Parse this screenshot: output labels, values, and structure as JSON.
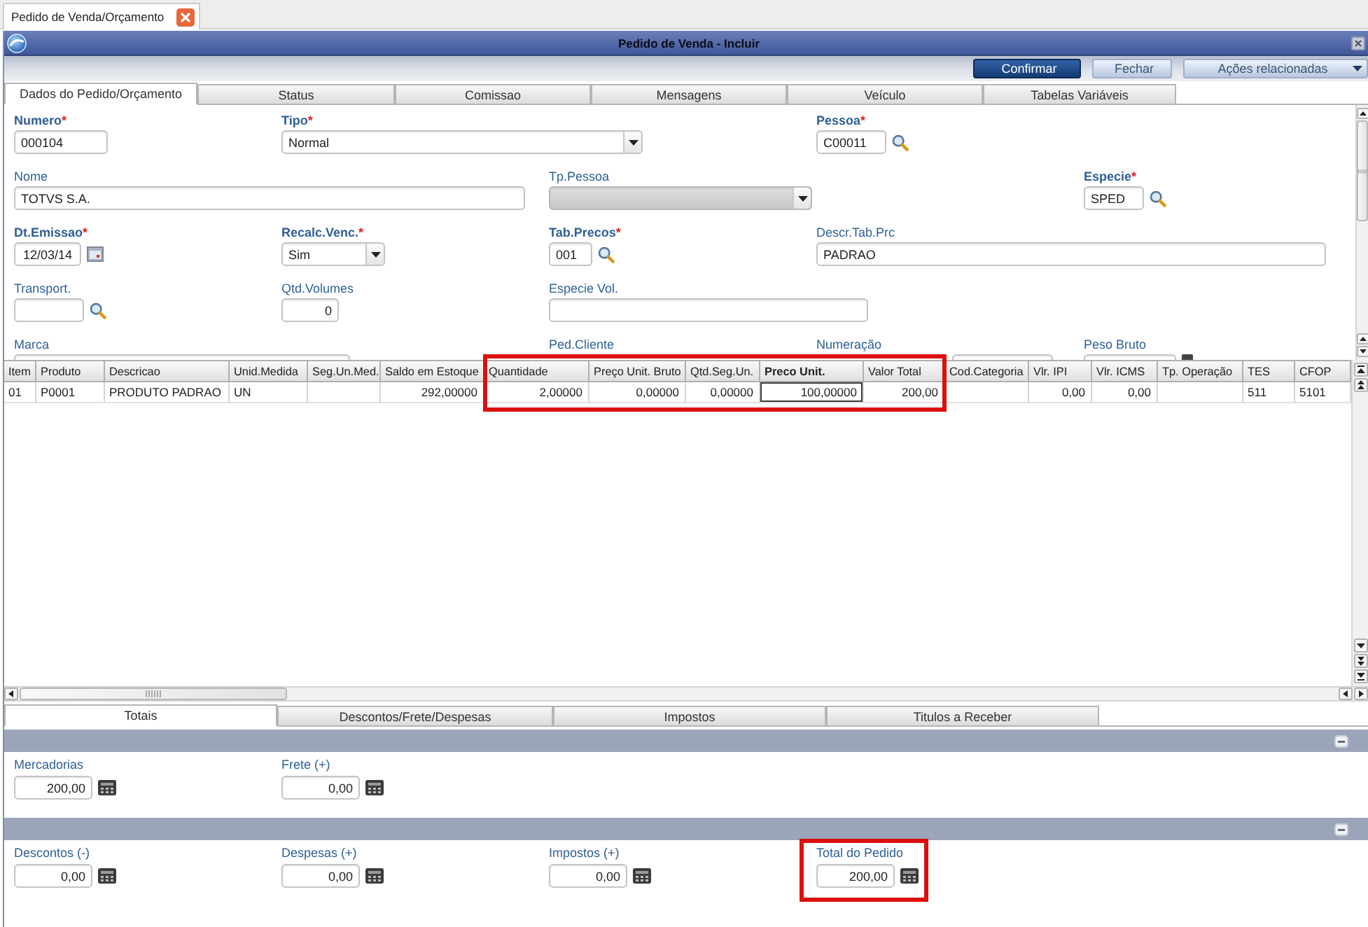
{
  "app_tab": {
    "label": "Pedido de Venda/Orçamento"
  },
  "window": {
    "title": "Pedido de Venda - Incluir"
  },
  "toolbar": [
    {
      "label": "Confirmar",
      "kind": "primary"
    },
    {
      "label": "Fechar",
      "kind": "secondary"
    },
    {
      "label": "Ações relacionadas",
      "kind": "menu"
    }
  ],
  "tabs": [
    {
      "label": "Dados do Pedido/Orçamento",
      "selected": true
    },
    {
      "label": "Status",
      "selected": false
    },
    {
      "label": "Comissao",
      "selected": false
    },
    {
      "label": "Mensagens",
      "selected": false
    },
    {
      "label": "Veículo",
      "selected": false
    },
    {
      "label": "Tabelas Variáveis",
      "selected": false
    }
  ],
  "form": [
    [
      {
        "label": "Numero",
        "mark": "*",
        "kind": "text",
        "value": "000104",
        "disabled": false
      },
      {
        "label": "Tipo",
        "mark": "*",
        "kind": "select",
        "value": "Normal",
        "disabled": false
      },
      {
        "label": "Pessoa",
        "mark": "*",
        "kind": "lookup",
        "value": "C00011",
        "disabled": false
      }
    ],
    [
      {
        "label": "Nome",
        "kind": "text",
        "value": "TOTVS S.A.",
        "disabled": false
      },
      {
        "label": "Tp.Pessoa",
        "kind": "select",
        "disabled": true
      },
      {
        "label": "Especie",
        "mark": "*",
        "kind": "lookup",
        "value": "SPED",
        "disabled": false
      }
    ],
    [
      {
        "label": "Dt.Emissao",
        "mark": "*",
        "kind": "date",
        "value": "12/03/14",
        "disabled": false
      },
      {
        "label": "Recalc.Venc.",
        "mark": "*",
        "kind": "select",
        "value": "Sim",
        "disabled": false
      },
      {
        "label": "Tab.Precos",
        "mark": "*",
        "kind": "lookup",
        "value": "001",
        "disabled": false
      },
      {
        "label": "Descr.Tab.Prc",
        "kind": "text",
        "value": "PADRAO",
        "disabled": false
      }
    ],
    [
      {
        "label": "Transport.",
        "kind": "lookup",
        "disabled": false
      },
      {
        "label": "Qtd.Volumes",
        "kind": "number",
        "value": "0",
        "disabled": false
      },
      {
        "label": "Especie Vol.",
        "kind": "text",
        "disabled": false
      }
    ],
    [
      {
        "label": "Marca",
        "kind": "text",
        "disabled": false
      },
      {
        "label": "Ped.Cliente"
      },
      {
        "label": "Numeração",
        "kind": "text",
        "disabled": false
      },
      {
        "label": "Peso Bruto",
        "kind": "calc",
        "disabled": false
      }
    ]
  ],
  "grid": {
    "column_groups": [
      {
        "highlighted": false,
        "columns": [
          {
            "label": "Item",
            "selected": false
          },
          {
            "label": "Produto",
            "selected": false
          },
          {
            "label": "Descricao",
            "selected": false
          },
          {
            "label": "Unid.Medida",
            "selected": false
          },
          {
            "label": "Seg.Un.Med.",
            "selected": false
          },
          {
            "label": "Saldo em Estoque",
            "selected": false
          }
        ]
      },
      {
        "highlighted": true,
        "columns": [
          {
            "label": "Quantidade",
            "selected": false
          },
          {
            "label": "Preço Unit. Bruto",
            "selected": false
          },
          {
            "label": "Qtd.Seg.Un.",
            "selected": false
          },
          {
            "label": "Preco Unit.",
            "selected": true
          },
          {
            "label": "Valor Total",
            "selected": false
          }
        ]
      },
      {
        "highlighted": false,
        "columns": [
          {
            "label": "Cod.Categoria",
            "selected": false
          },
          {
            "label": "Vlr. IPI",
            "selected": false
          },
          {
            "label": "Vlr. ICMS",
            "selected": false
          },
          {
            "label": "Tp. Operação",
            "selected": false
          },
          {
            "label": "TES",
            "selected": false
          },
          {
            "label": "CFOP",
            "selected": false
          }
        ]
      }
    ],
    "rows": [
      {
        "cells": [
          "01",
          "P0001",
          "PRODUTO PADRAO",
          "UN",
          null,
          "292,00000",
          "2,00000",
          "0,00000",
          "0,00000",
          "100,00000",
          "200,00",
          null,
          "0,00",
          "0,00",
          null,
          "511",
          "5101"
        ]
      }
    ]
  },
  "bottom_tabs": [
    {
      "label": "Totais",
      "selected": true
    },
    {
      "label": "Descontos/Frete/Despesas",
      "selected": false
    },
    {
      "label": "Impostos",
      "selected": false
    },
    {
      "label": "Titulos a Receber",
      "selected": false
    }
  ],
  "totals": [
    {
      "expanded": true,
      "fields": [
        {
          "label": "Mercadorias",
          "value": "200,00",
          "highlighted": false
        },
        {
          "label": "Frete (+)",
          "value": "0,00",
          "highlighted": false
        }
      ]
    },
    {
      "expanded": true,
      "fields": [
        {
          "label": "Descontos (-)",
          "value": "0,00",
          "highlighted": false
        },
        {
          "label": "Despesas (+)",
          "value": "0,00",
          "highlighted": false
        },
        {
          "label": "Impostos (+)",
          "value": "0,00",
          "highlighted": false
        },
        {
          "label": "Total do Pedido",
          "value": "200,00",
          "highlighted": true
        }
      ]
    }
  ]
}
